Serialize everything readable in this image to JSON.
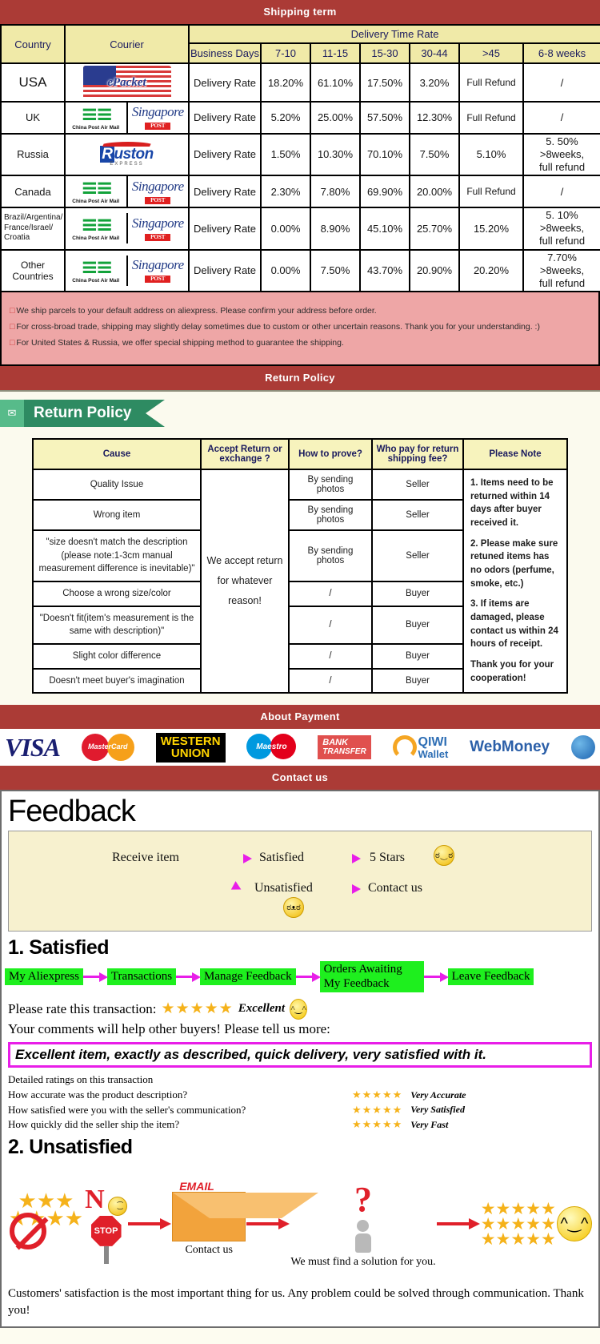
{
  "banners": {
    "shipping": "Shipping term",
    "return": "Return Policy",
    "payment": "About Payment",
    "contact": "Contact us"
  },
  "shipping": {
    "headers": {
      "country": "Country",
      "courier": "Courier",
      "delivery_time_rate": "Delivery Time Rate",
      "business_days": "Business Days",
      "cols": [
        "7-10",
        "11-15",
        "15-30",
        "30-44",
        ">45",
        "6-8 weeks"
      ]
    },
    "rate_label": "Delivery Rate",
    "rows": [
      {
        "country": "USA",
        "couriers": [
          "epacket"
        ],
        "values": [
          "18.20%",
          "61.10%",
          "17.50%",
          "3.20%",
          "Full Refund",
          "/"
        ]
      },
      {
        "country": "UK",
        "couriers": [
          "china-post-air-mail",
          "singapore-post"
        ],
        "values": [
          "5.20%",
          "25.00%",
          "57.50%",
          "12.30%",
          "Full Refund",
          "/"
        ]
      },
      {
        "country": "Russia",
        "couriers": [
          "ruston-express"
        ],
        "values": [
          "1.50%",
          "10.30%",
          "70.10%",
          "7.50%",
          "5.10%",
          "5. 50%\n>8weeks,\nfull refund"
        ]
      },
      {
        "country": "Canada",
        "couriers": [
          "china-post-air-mail",
          "singapore-post"
        ],
        "values": [
          "2.30%",
          "7.80%",
          "69.90%",
          "20.00%",
          "Full Refund",
          "/"
        ]
      },
      {
        "country": "Brazil/Argentina/\nFrance/Israel/\nCroatia",
        "couriers": [
          "china-post-air-mail",
          "singapore-post"
        ],
        "values": [
          "0.00%",
          "8.90%",
          "45.10%",
          "25.70%",
          "15.20%",
          "5. 10%\n>8weeks,\nfull refund"
        ]
      },
      {
        "country": "Other Countries",
        "couriers": [
          "china-post-air-mail",
          "singapore-post"
        ],
        "values": [
          "0.00%",
          "7.50%",
          "43.70%",
          "20.90%",
          "20.20%",
          "7.70%\n>8weeks,\nfull refund"
        ]
      }
    ],
    "notes": [
      "We ship parcels to your default address on aliexpress. Please confirm your address before order.",
      "For cross-broad trade, shipping may slightly delay sometimes due to custom or other uncertain reasons. Thank you for your understanding. :)",
      "For United States & Russia, we offer special shipping method to guarantee the shipping."
    ]
  },
  "return_policy": {
    "ribbon_label": "Return Policy",
    "headers": [
      "Cause",
      "Accept Return or exchange ?",
      "How to prove?",
      "Who pay for return shipping fee?",
      "Please Note"
    ],
    "accept_text": "We accept return for whatever reason!",
    "rows": [
      {
        "cause": "Quality Issue",
        "prove": "By sending photos",
        "payer": "Seller"
      },
      {
        "cause": "Wrong item",
        "prove": "By sending photos",
        "payer": "Seller"
      },
      {
        "cause": "\"size doesn't match the description (please note:1-3cm manual measurement difference is inevitable)\"",
        "prove": "By sending photos",
        "payer": "Seller"
      },
      {
        "cause": "Choose a wrong size/color",
        "prove": "/",
        "payer": "Buyer"
      },
      {
        "cause": "\"Doesn't fit(item's measurement is the same with description)\"",
        "prove": "/",
        "payer": "Buyer"
      },
      {
        "cause": "Slight color difference",
        "prove": "/",
        "payer": "Buyer"
      },
      {
        "cause": "Doesn't meet buyer's imagination",
        "prove": "/",
        "payer": "Buyer"
      }
    ],
    "notes": [
      "1. Items need to be returned within 14 days after buyer received it.",
      "2. Please make sure retuned items has no odors (perfume, smoke, etc.)",
      "3. If items are damaged, please contact us within 24 hours of receipt.",
      "Thank you for your cooperation!"
    ]
  },
  "payment": {
    "methods": [
      {
        "name": "visa",
        "label": "VISA"
      },
      {
        "name": "mastercard",
        "label": "MasterCard"
      },
      {
        "name": "western-union",
        "line1": "WESTERN",
        "line2": "UNION"
      },
      {
        "name": "maestro",
        "label": "Maestro"
      },
      {
        "name": "bank-transfer",
        "line1": "BANK",
        "line2": "TRANSFER"
      },
      {
        "name": "qiwi-wallet",
        "line1": "QIWI",
        "line2": "Wallet"
      },
      {
        "name": "webmoney",
        "label": "WebMoney"
      },
      {
        "name": "webmoney-globe",
        "label": ""
      }
    ]
  },
  "feedback": {
    "title": "Feedback",
    "flow": {
      "receive_item": "Receive item",
      "satisfied": "Satisfied",
      "five_stars": "5 Stars",
      "unsatisfied": "Unsatisfied",
      "contact_us": "Contact us",
      "happy_face": "ಠ‿ಠ",
      "sad_face": "ಠᴥಠ"
    },
    "satisfied": {
      "heading": "1. Satisfied",
      "steps": [
        "My Aliexpress",
        "Transactions",
        "Manage Feedback",
        "Orders Awaiting My Feedback",
        "Leave Feedback"
      ],
      "rate_prompt": "Please rate this transaction:",
      "stars": "★★★★★",
      "rating_word": "Excellent",
      "comments_prompt": "Your comments will help other buyers! Please tell us more:",
      "comment_text": "Excellent item, exactly as described, quick delivery, very satisfied with it.",
      "detailed_heading": "Detailed ratings on this transaction",
      "detailed": [
        {
          "question": "How accurate was the product description?",
          "stars": "★★★★★",
          "value": "Very Accurate"
        },
        {
          "question": "How satisfied were you with the seller's communication?",
          "stars": "★★★★★",
          "value": "Very Satisfied"
        },
        {
          "question": "How quickly did the seller ship the item?",
          "stars": "★★★★★",
          "value": "Very Fast"
        }
      ]
    },
    "unsatisfied": {
      "heading": "2. Unsatisfied",
      "no_letter": "N",
      "stop_label": "STOP",
      "email_label": "EMAIL",
      "contact_caption": "Contact us",
      "solution_caption": "We must find a solution for you.",
      "closing": "Customers' satisfaction is the most important thing for us. Any problem could be solved through communication. Thank you!"
    }
  }
}
